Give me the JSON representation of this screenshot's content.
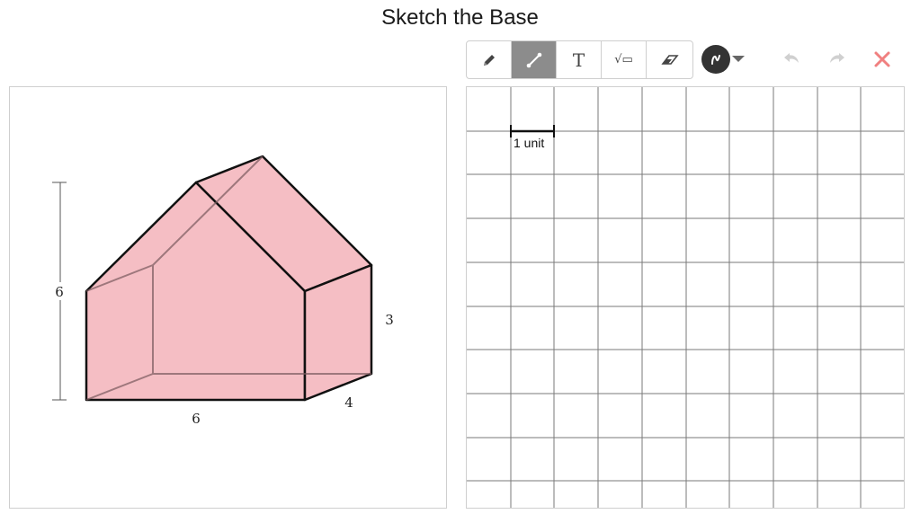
{
  "page": {
    "title": "Sketch the Base"
  },
  "toolbar": {
    "tools": [
      {
        "name": "pencil",
        "icon": "pencil-icon",
        "active": false
      },
      {
        "name": "line",
        "icon": "line-segment-icon",
        "active": true
      },
      {
        "name": "text",
        "icon": "text-icon",
        "glyph": "T",
        "active": false
      },
      {
        "name": "math",
        "icon": "square-root-icon",
        "glyph": "√▭",
        "active": false
      },
      {
        "name": "eraser",
        "icon": "eraser-icon",
        "active": false
      }
    ],
    "color": {
      "icon": "color-swatch-icon",
      "value": "#333333"
    },
    "undo_icon": "undo-icon",
    "redo_icon": "redo-icon",
    "clear_icon": "close-icon",
    "clear_color": "#f08080"
  },
  "figure": {
    "fill_color": "#f5bec4",
    "labels": {
      "height": "6",
      "base_width": "6",
      "side_height": "3",
      "depth": "4"
    }
  },
  "canvas": {
    "scale_label": "1 unit"
  }
}
